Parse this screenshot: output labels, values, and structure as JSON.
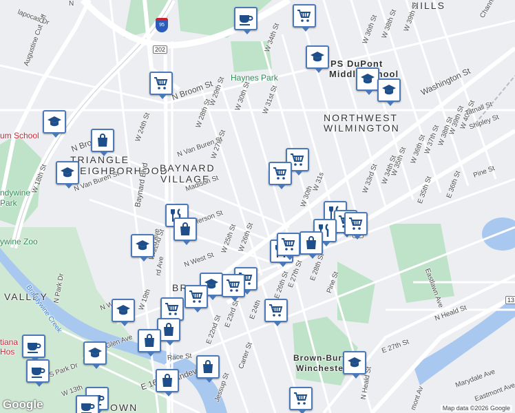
{
  "map": {
    "attribution": "Map data ©2026 Google",
    "logo": "Google",
    "route_shields": {
      "i95": "95",
      "us202": "202",
      "shield_13_right": "13",
      "shield_13_bottom": "13"
    },
    "places": [
      "Haynes Park",
      "PS DuPont",
      "Middle School",
      "HILLS",
      "NORTHWEST",
      "WILMINGTON",
      "TRIANGLE",
      "NEIGHBORHOOD",
      "BAYNARD",
      "VILLAGE",
      "ndywine",
      "Park",
      "ywine Zoo",
      "VALLEY",
      "Brown-Burto",
      "Winchester",
      "tiana",
      "Hos",
      "BR",
      "OWN",
      "um School"
    ],
    "streets": [
      "W 18th St",
      "W 24th St",
      "N Broom St",
      "N Bro",
      "W 29th St",
      "W 28th St",
      "W 27th St",
      "W 30th St",
      "W 31st St",
      "W 34th St",
      "W 36th St",
      "W 38th St",
      "W 39th St",
      "Channing",
      "Washington St",
      "N Van Buren St",
      "Madison St",
      "Baynard Blvd",
      "N Van Buren St",
      "W 22nd St",
      "efferson St",
      "N West St",
      "W 25th St",
      "W 26th St",
      "N Park Dr",
      "Brandywine Creek",
      "N W",
      "W 19th",
      "Glen Ave",
      "Race St",
      "E 23rd St",
      "E 22nd St",
      "Vandever",
      "Carter St",
      "E 24th",
      "E 26th St",
      "E 27th St",
      "E 28th St",
      "Pine St",
      "E 27th St",
      "N Heald St",
      "Pine St",
      "E 35th St",
      "E 36th St",
      "Eastlawn Ave",
      "W 33rd St",
      "W 34th St",
      "W 35th St",
      "W 36th St",
      "W 37th St",
      "W 38th St",
      "W 39th St",
      "W 40th St",
      "Tatnall St",
      "Shipley St",
      "W 30th",
      "W 31s",
      "N Heald St",
      "Jessup St",
      "Augustine Cut Off",
      "lapocas Dr",
      "N",
      "rd Ave",
      "cord Ave",
      "E 16",
      "S Park Dr",
      "Eastmont Ave",
      "Marydale Ave",
      "mont Av",
      "W 13th"
    ],
    "markers": [
      {
        "kind": "cafe-icon"
      },
      {
        "kind": "grocery-cart-icon"
      },
      {
        "kind": "school-icon"
      },
      {
        "kind": "grocery-cart-icon"
      },
      {
        "kind": "school-icon"
      },
      {
        "kind": "school-icon"
      },
      {
        "kind": "school-icon"
      },
      {
        "kind": "shopping-bag-icon"
      },
      {
        "kind": "school-icon"
      },
      {
        "kind": "grocery-cart-icon"
      },
      {
        "kind": "grocery-cart-icon"
      },
      {
        "kind": "restaurant-icon"
      },
      {
        "kind": "shopping-bag-icon"
      },
      {
        "kind": "school-icon"
      },
      {
        "kind": "restaurant-icon"
      },
      {
        "kind": "grocery-cart-icon"
      },
      {
        "kind": "grocery-cart-icon"
      },
      {
        "kind": "restaurant-icon"
      },
      {
        "kind": "restaurant-icon"
      },
      {
        "kind": "shopping-bag-icon"
      },
      {
        "kind": "grocery-cart-icon"
      },
      {
        "kind": "grocery-cart-icon"
      },
      {
        "kind": "school-icon"
      },
      {
        "kind": "grocery-cart-icon"
      },
      {
        "kind": "grocery-cart-icon"
      },
      {
        "kind": "school-icon"
      },
      {
        "kind": "grocery-cart-icon"
      },
      {
        "kind": "shopping-bag-icon"
      },
      {
        "kind": "shopping-bag-icon"
      },
      {
        "kind": "cafe-icon"
      },
      {
        "kind": "school-icon"
      },
      {
        "kind": "cafe-icon"
      },
      {
        "kind": "shopping-bag-icon"
      },
      {
        "kind": "shopping-bag-icon"
      },
      {
        "kind": "cafe-icon"
      },
      {
        "kind": "cafe-icon"
      },
      {
        "kind": "grocery-cart-icon"
      },
      {
        "kind": "school-icon"
      },
      {
        "kind": "grocery-cart-icon"
      }
    ],
    "colors": {
      "water": "#a8c8f0",
      "park": "#bfe3c8",
      "highway": "#ffffff",
      "marker_border": "#4a78b8",
      "marker_icon": "#1f4f8a"
    }
  }
}
